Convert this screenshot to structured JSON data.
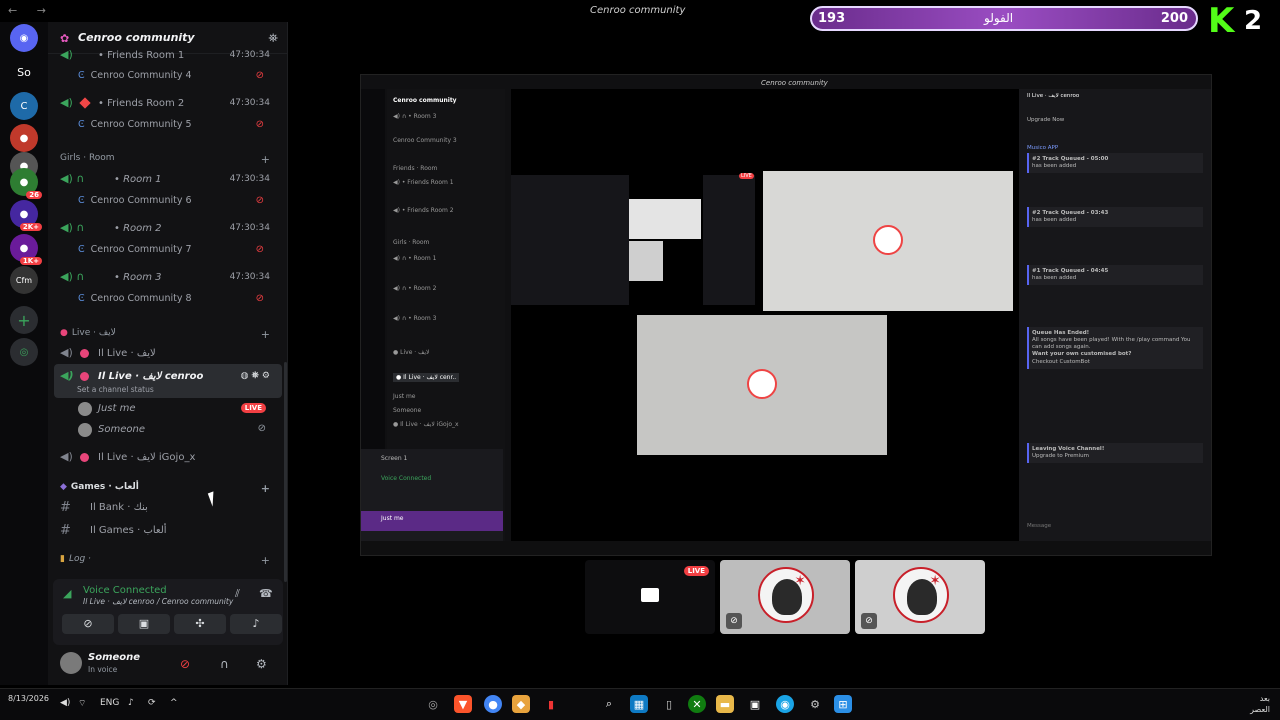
{
  "window": {
    "title": "Cenroo community",
    "nav": "← →"
  },
  "overlay": {
    "score_left": "193",
    "score_mid": "الفولو",
    "score_right": "200",
    "logo": "K",
    "logo_num": "2",
    "accent": "#53fc18"
  },
  "rail": {
    "servers": [
      {
        "icon": "discord-icon",
        "label": "◉"
      },
      {
        "icon": "server-so",
        "label": "So"
      },
      {
        "icon": "server-c",
        "label": "C"
      },
      {
        "icon": "server-avatar-1",
        "label": "●",
        "badge": ""
      },
      {
        "icon": "server-avatar-2",
        "label": "●"
      },
      {
        "icon": "server-avatar-3",
        "label": "●",
        "badge": "26"
      },
      {
        "icon": "server-avatar-4",
        "label": "●",
        "badge": "2K+"
      },
      {
        "icon": "server-avatar-5",
        "label": "●",
        "badge": "1K+"
      },
      {
        "icon": "server-cfm",
        "label": "Cfm"
      },
      {
        "icon": "add-server-icon",
        "label": "+"
      },
      {
        "icon": "discover-icon",
        "label": "◎"
      }
    ]
  },
  "guild": {
    "name": "Cenroo community",
    "chevron": "⌄"
  },
  "channels": {
    "rows": [
      {
        "label": "• Friends Room 1",
        "time": "47:30:34"
      },
      {
        "label": "Cenroo Community 4"
      },
      {
        "label": "• Friends Room 2",
        "time": "47:30:34"
      },
      {
        "label": "Cenroo Community 5"
      }
    ],
    "girls_category": "Girls · Room",
    "girls_rows": [
      {
        "label": "• Room 1",
        "time": "47:30:34",
        "sub": "Cenroo Community 6"
      },
      {
        "label": "• Room 2",
        "time": "47:30:34",
        "sub": "Cenroo Community 7"
      },
      {
        "label": "• Room 3",
        "time": "47:30:34",
        "sub": "Cenroo Community 8"
      }
    ],
    "live_category": "Live · لايف",
    "live_rows": [
      {
        "label": "Il Live · لايف"
      },
      {
        "label": "Il Live · لايف cenroo",
        "status": "Set a channel status"
      },
      {
        "label": "Il Live · لايف iGojo_x"
      }
    ],
    "users": [
      {
        "name": "Just me",
        "live": "LIVE"
      },
      {
        "name": "Someone"
      }
    ],
    "games_category": "Games · ألعاب",
    "games_rows": [
      {
        "label": "Il Bank · بنك"
      },
      {
        "label": "Il Games · ألعاب"
      }
    ],
    "log_category": "Log ·"
  },
  "voice": {
    "title": "Voice Connected",
    "subtitle": "Il Live · لايف cenroo / Cenroo community",
    "user_name": "Someone",
    "user_status": "In voice"
  },
  "stage": {
    "mini_title": "Cenroo community",
    "chat_lines": [
      "Upgrade Now",
      "Musico APP",
      "#2 Track Queued - 05:00",
      "has been added",
      "#2 Track Queued - 03:43",
      "has been added",
      "#1 Track Queued - 04:45",
      "has been added",
      "Queue Has Ended!",
      "All songs have been played! With the /play command You can add songs again.",
      "Want your own customised bot?",
      "Checkout CustomBot",
      "Leaving Voice Channel!",
      "Upgrade to Premium",
      "Message",
      "Il Live · لايف cenroo"
    ],
    "mini_voice": "Voice Connected",
    "mini_screen": "Screen 1",
    "mini_user": "Just me",
    "live_label": "LIVE"
  },
  "taskbar": {
    "date": "8/13/2026",
    "lang": "ENG",
    "right_time": "العصر",
    "right_date": "بعد"
  }
}
